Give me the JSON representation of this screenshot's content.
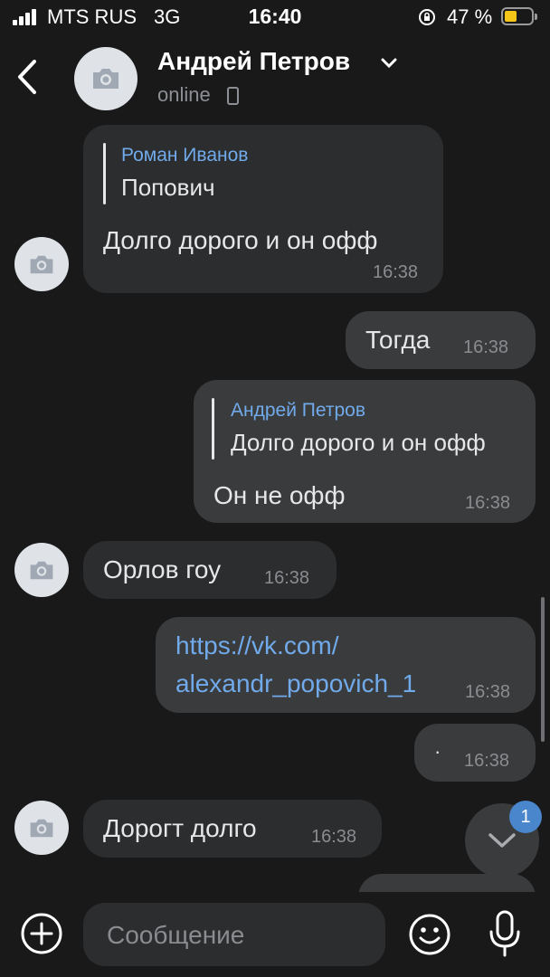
{
  "status_bar": {
    "carrier": "MTS RUS",
    "network": "3G",
    "time": "16:40",
    "battery_percent": "47 %",
    "battery_level": 0.47,
    "signal_icon": "signal-bars-icon",
    "lock_icon": "rotation-lock-icon",
    "battery_color": "#f5c518"
  },
  "header": {
    "name": "Андрей Петров",
    "status": "online",
    "status_icon": "phone-icon",
    "back_icon": "chevron-left-icon",
    "expand_icon": "chevron-down-icon",
    "avatar_icon": "camera-icon"
  },
  "messages": [
    {
      "direction": "in",
      "reply_author": "Роман Иванов",
      "reply_text": "Попович",
      "text": "Долго дорого и он офф",
      "time": "16:38"
    },
    {
      "direction": "out",
      "text": "Тогда",
      "time": "16:38"
    },
    {
      "direction": "out",
      "reply_author": "Андрей Петров",
      "reply_text": "Долго дорого и он офф",
      "text": "Он не офф",
      "time": "16:38"
    },
    {
      "direction": "in",
      "text": "Орлов гоу",
      "time": "16:38"
    },
    {
      "direction": "out",
      "link_line1": "https://vk.com/",
      "link_line2": "alexandr_popovich_1",
      "time": "16:38"
    },
    {
      "direction": "out",
      "text": "·",
      "time": "16:38"
    },
    {
      "direction": "in",
      "text": "Дорогт долго",
      "time": "16:38"
    }
  ],
  "scroll_down": {
    "badge": "1",
    "icon": "chevron-down-icon"
  },
  "composer": {
    "placeholder": "Сообщение",
    "add_icon": "plus-circle-icon",
    "emoji_icon": "smile-icon",
    "mic_icon": "microphone-icon"
  },
  "colors": {
    "background": "#19191a",
    "bubble_in": "#2c2d2e",
    "bubble_out": "#3a3b3c",
    "link": "#71aaeb",
    "badge": "#4986cc"
  }
}
